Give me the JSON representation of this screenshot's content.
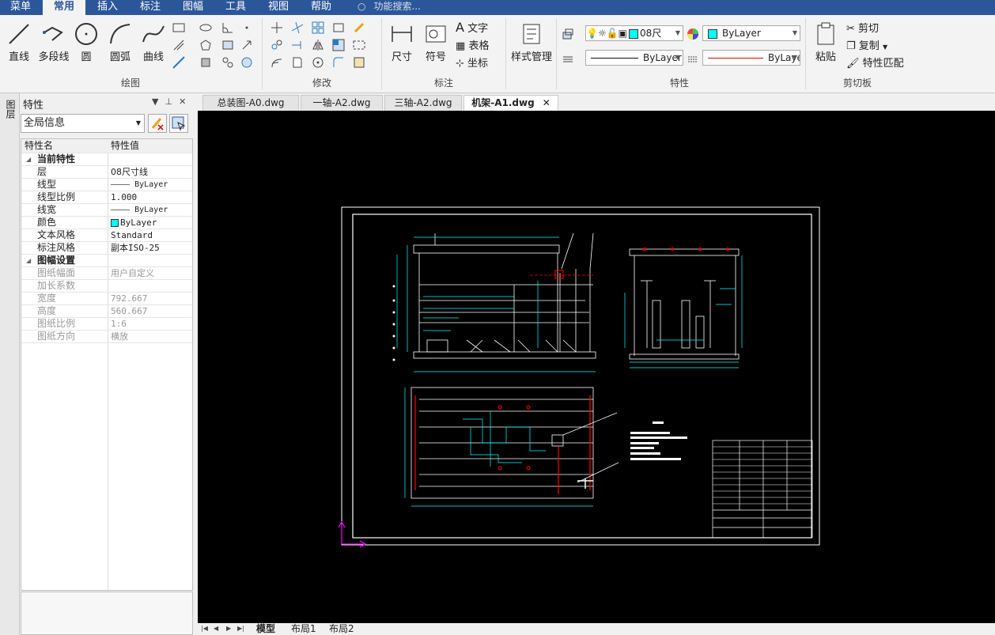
{
  "menubar": {
    "items": [
      "菜单",
      "常用",
      "插入",
      "标注",
      "图幅",
      "工具",
      "视图",
      "帮助"
    ],
    "active": "常用",
    "search_placeholder": "功能搜索..."
  },
  "ribbon": {
    "draw": {
      "label": "绘图",
      "line": "直线",
      "polyline": "多段线",
      "circle": "圆",
      "arc": "圆弧",
      "curve": "曲线"
    },
    "modify": {
      "label": "修改"
    },
    "annotate": {
      "label": "标注",
      "dimension": "尺寸",
      "symbol": "符号",
      "text": "文字",
      "table": "表格",
      "coordinate": "坐标"
    },
    "style": {
      "label": "样式管理"
    },
    "properties": {
      "label": "特性",
      "layer_combo": "08尺",
      "color_combo": "ByLayer",
      "linetype_combo": "ByLayer",
      "lineweight_combo": "ByLaye"
    },
    "clipboard": {
      "label": "剪切板",
      "paste": "粘贴",
      "cut": "剪切",
      "copy": "复制",
      "match": "特性匹配"
    }
  },
  "properties_panel": {
    "title": "特性",
    "vertical_tab": "图层",
    "selector": "全局信息",
    "header": {
      "name": "特性名",
      "value": "特性值"
    },
    "sections": [
      {
        "title": "当前特性",
        "rows": [
          {
            "name": "层",
            "value": "08尺寸线"
          },
          {
            "name": "线型",
            "value": "———— ByLayer"
          },
          {
            "name": "线型比例",
            "value": "1.000"
          },
          {
            "name": "线宽",
            "value": "———— ByLayer"
          },
          {
            "name": "颜色",
            "value": "ByLayer"
          },
          {
            "name": "文本风格",
            "value": "Standard"
          },
          {
            "name": "标注风格",
            "value": "副本ISO-25"
          }
        ]
      },
      {
        "title": "图幅设置",
        "rows": [
          {
            "name": "图纸幅面",
            "value": "用户自定义"
          },
          {
            "name": "加长系数",
            "value": ""
          },
          {
            "name": "宽度",
            "value": "792.667"
          },
          {
            "name": "高度",
            "value": "560.667"
          },
          {
            "name": "图纸比例",
            "value": "1:6"
          },
          {
            "name": "图纸方向",
            "value": "横放"
          }
        ]
      }
    ]
  },
  "doc_tabs": [
    {
      "label": "总装图-A0.dwg",
      "active": false
    },
    {
      "label": "一轴-A2.dwg",
      "active": false
    },
    {
      "label": "三轴-A2.dwg",
      "active": false
    },
    {
      "label": "机架-A1.dwg",
      "active": true
    }
  ],
  "layout_tabs": [
    "模型",
    "布局1",
    "布局2"
  ],
  "colors": {
    "menubar": "#2b579a",
    "canvas": "#000000",
    "drawing_cyan": "#00ffff",
    "drawing_red": "#ff0000",
    "drawing_white": "#ffffff",
    "ucs_magenta": "#ff00ff"
  }
}
